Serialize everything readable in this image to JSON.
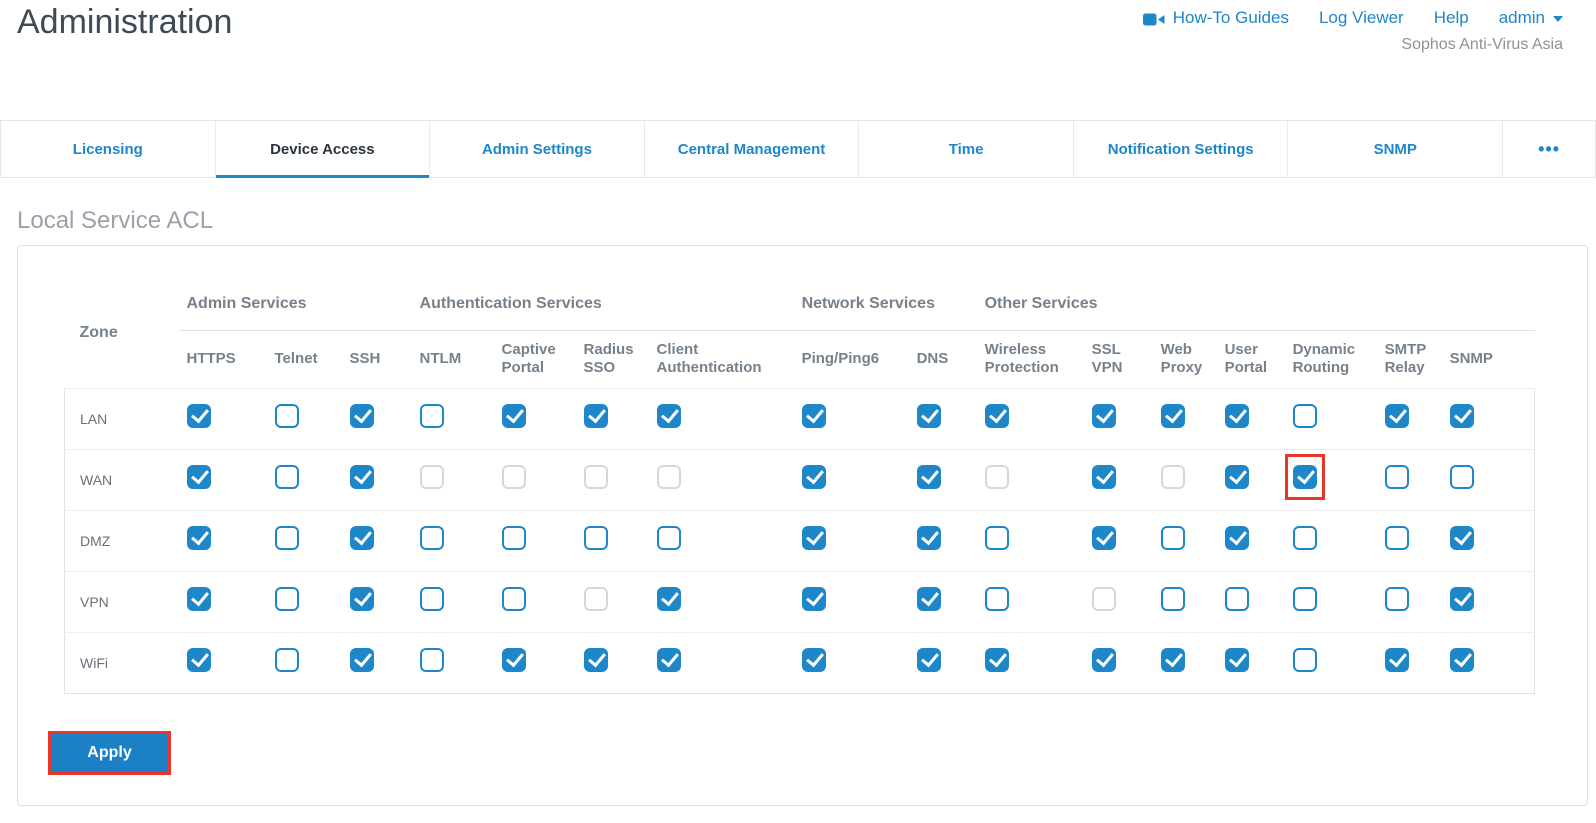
{
  "header": {
    "title": "Administration",
    "links": [
      {
        "label": "How-To Guides",
        "icon": "video-camera-icon"
      },
      {
        "label": "Log Viewer"
      },
      {
        "label": "Help"
      },
      {
        "label": "admin",
        "icon": "chevron-down-icon"
      }
    ],
    "appliance_name": "Sophos Anti-Virus Asia"
  },
  "tabs": {
    "items": [
      {
        "label": "Licensing",
        "active": false
      },
      {
        "label": "Device Access",
        "active": true
      },
      {
        "label": "Admin Settings",
        "active": false
      },
      {
        "label": "Central Management",
        "active": false
      },
      {
        "label": "Time",
        "active": false
      },
      {
        "label": "Notification Settings",
        "active": false
      },
      {
        "label": "SNMP",
        "active": false
      }
    ],
    "overflow_label": "•••"
  },
  "section_title": "Local Service ACL",
  "acl_table": {
    "zone_header": "Zone",
    "groups": [
      {
        "label": "Admin Services",
        "span": 3
      },
      {
        "label": "Authentication Services",
        "span": 4
      },
      {
        "label": "Network Services",
        "span": 2
      },
      {
        "label": "Other Services",
        "span": 7
      }
    ],
    "columns": [
      "HTTPS",
      "Telnet",
      "SSH",
      "NTLM",
      "Captive Portal",
      "Radius SSO",
      "Client Authentication",
      "Ping/Ping6",
      "DNS",
      "Wireless Protection",
      "SSL VPN",
      "Web Proxy",
      "User Portal",
      "Dynamic Routing",
      "SMTP Relay",
      "SNMP"
    ],
    "rows": [
      {
        "zone": "LAN",
        "states": [
          "checked",
          "unchecked",
          "checked",
          "unchecked",
          "checked",
          "checked",
          "checked",
          "checked",
          "checked",
          "checked",
          "checked",
          "checked",
          "checked",
          "unchecked",
          "checked",
          "checked"
        ]
      },
      {
        "zone": "WAN",
        "states": [
          "checked",
          "unchecked",
          "checked",
          "disabled",
          "disabled",
          "disabled",
          "disabled",
          "checked",
          "checked",
          "disabled",
          "checked",
          "disabled",
          "checked",
          "checked-highlighted",
          "unchecked",
          "unchecked"
        ]
      },
      {
        "zone": "DMZ",
        "states": [
          "checked",
          "unchecked",
          "checked",
          "unchecked",
          "unchecked",
          "unchecked",
          "unchecked",
          "checked",
          "checked",
          "unchecked",
          "checked",
          "unchecked",
          "checked",
          "unchecked",
          "unchecked",
          "checked"
        ]
      },
      {
        "zone": "VPN",
        "states": [
          "checked",
          "unchecked",
          "checked",
          "unchecked",
          "unchecked",
          "disabled",
          "checked",
          "checked",
          "checked",
          "unchecked",
          "disabled",
          "unchecked",
          "unchecked",
          "unchecked",
          "unchecked",
          "checked"
        ]
      },
      {
        "zone": "WiFi",
        "states": [
          "checked",
          "unchecked",
          "checked",
          "unchecked",
          "checked",
          "checked",
          "checked",
          "checked",
          "checked",
          "checked",
          "checked",
          "checked",
          "checked",
          "unchecked",
          "checked",
          "checked"
        ]
      }
    ]
  },
  "apply_button": {
    "label": "Apply",
    "highlighted": true
  },
  "colors": {
    "accent_blue": "#1e87c9",
    "button_blue": "#1b80c4",
    "highlight_red": "#e9362a",
    "title_gray": "#3e4a56",
    "section_gray": "#99a2ab"
  }
}
